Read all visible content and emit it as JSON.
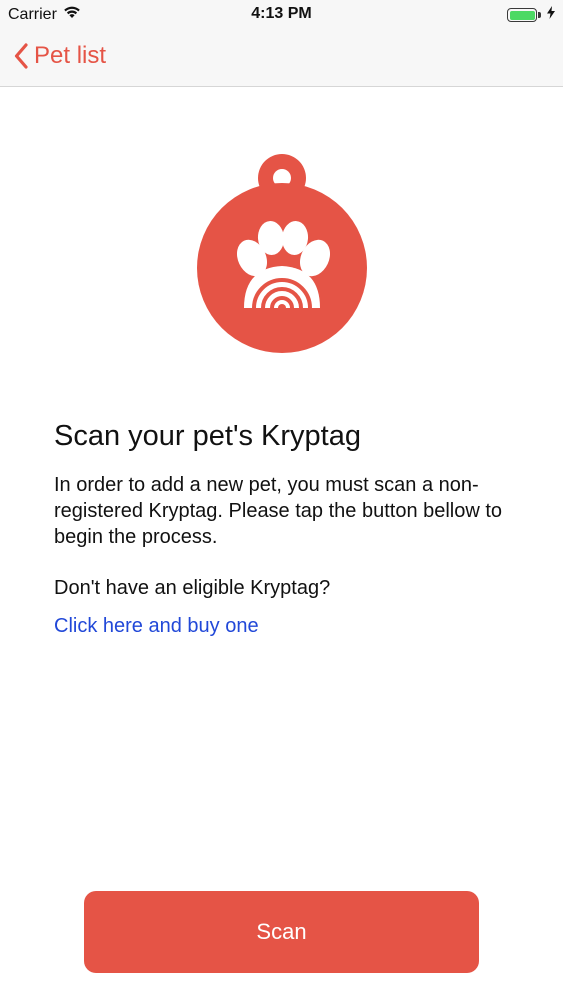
{
  "status_bar": {
    "carrier": "Carrier",
    "time": "4:13 PM",
    "battery_level": 1.0,
    "icons": [
      "wifi-icon",
      "battery-icon",
      "charging-bolt-icon"
    ]
  },
  "nav": {
    "back_label": "Pet list",
    "back_icon": "chevron-left-icon"
  },
  "logo": {
    "icon": "paw-tag-icon",
    "color": "#e55446"
  },
  "content": {
    "title": "Scan your pet's Kryptag",
    "description": "In order to add a new pet, you must scan a non-registered Kryptag. Please tap the button bellow to begin the process.",
    "question": "Don't have an eligible Kryptag?",
    "link_label": "Click here and buy one"
  },
  "actions": {
    "scan_label": "Scan"
  },
  "colors": {
    "accent": "#e55446",
    "link": "#2148d8",
    "battery": "#4cd964"
  }
}
